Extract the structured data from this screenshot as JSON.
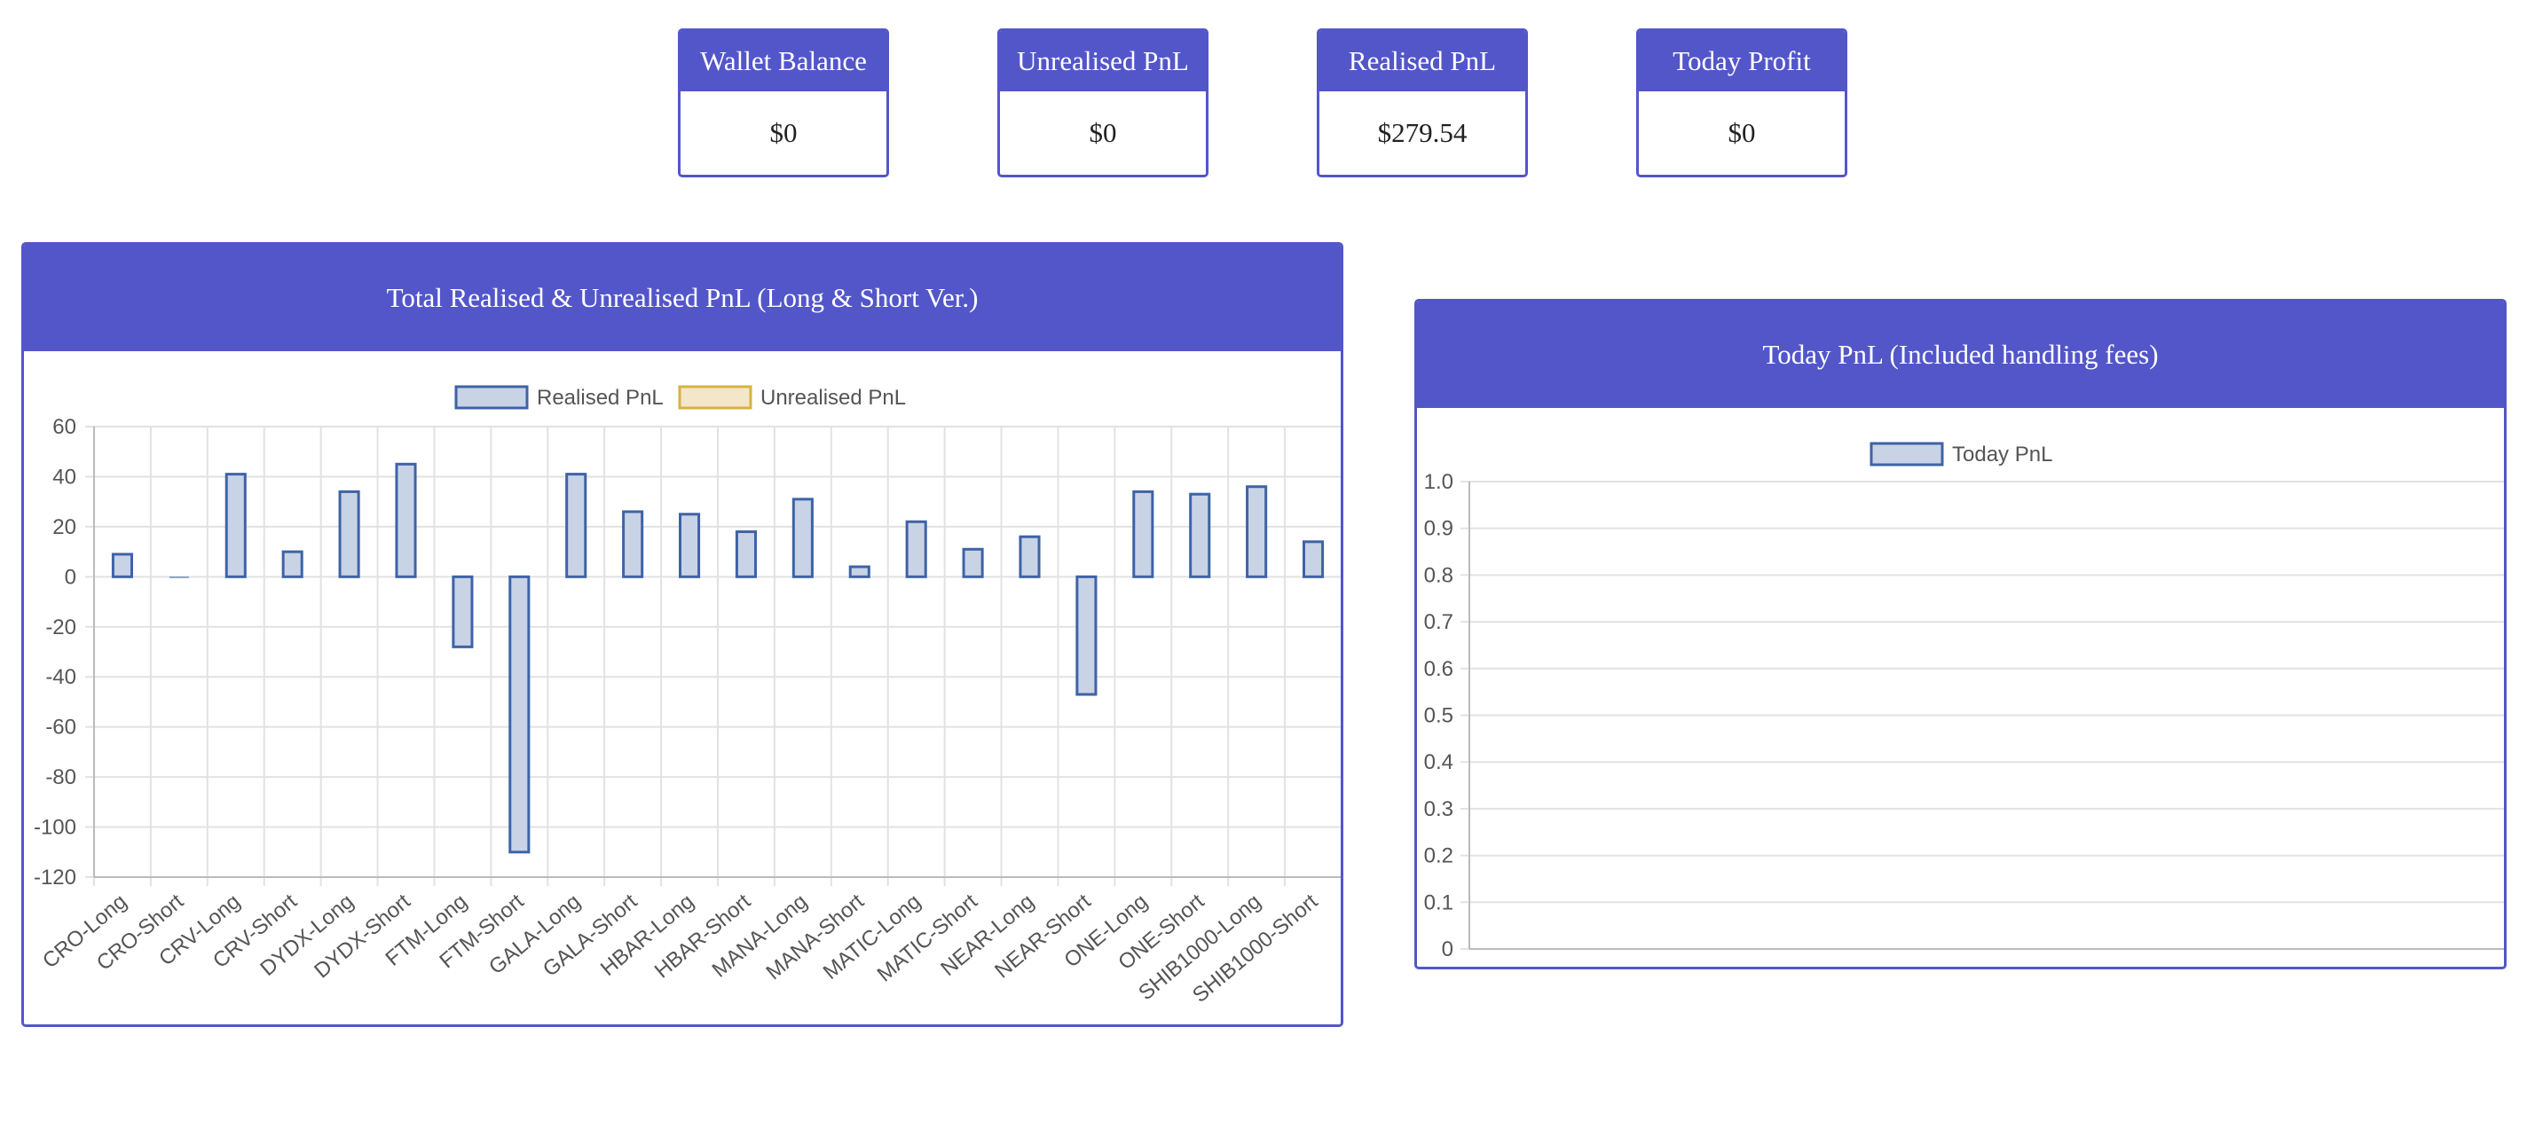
{
  "stats": [
    {
      "label": "Wallet Balance",
      "value": "$0"
    },
    {
      "label": "Unrealised PnL",
      "value": "$0"
    },
    {
      "label": "Realised PnL",
      "value": "$279.54"
    },
    {
      "label": "Today Profit",
      "value": "$0"
    }
  ],
  "panels": {
    "total": {
      "title": "Total Realised & Unrealised PnL (Long & Short Ver.)"
    },
    "today": {
      "title": "Today PnL (Included handling fees)"
    }
  },
  "colors": {
    "accent": "#5356c9",
    "bar_fill": "#c9d3e6",
    "bar_stroke": "#3e63a6",
    "unrealised_fill": "#f4e6c8",
    "unrealised_stroke": "#d8b23e",
    "grid": "#e2e2e2"
  },
  "chart_data": [
    {
      "type": "bar",
      "categories": [
        "CRO-Long",
        "CRO-Short",
        "CRV-Long",
        "CRV-Short",
        "DYDX-Long",
        "DYDX-Short",
        "FTM-Long",
        "FTM-Short",
        "GALA-Long",
        "GALA-Short",
        "HBAR-Long",
        "HBAR-Short",
        "MANA-Long",
        "MANA-Short",
        "MATIC-Long",
        "MATIC-Short",
        "NEAR-Long",
        "NEAR-Short",
        "ONE-Long",
        "ONE-Short",
        "SHIB1000-Long",
        "SHIB1000-Short"
      ],
      "series": [
        {
          "name": "Realised PnL",
          "values": [
            9,
            0,
            41,
            10,
            34,
            45,
            -28,
            -110,
            41,
            26,
            25,
            18,
            31,
            4,
            22,
            11,
            16,
            -47,
            34,
            33,
            36,
            14
          ]
        },
        {
          "name": "Unrealised PnL",
          "values": [
            0,
            0,
            0,
            0,
            0,
            0,
            0,
            0,
            0,
            0,
            0,
            0,
            0,
            0,
            0,
            0,
            0,
            0,
            0,
            0,
            0,
            0
          ]
        }
      ],
      "ylim": [
        -120,
        60
      ],
      "yticks": [
        60,
        40,
        20,
        0,
        -20,
        -40,
        -60,
        -80,
        -100,
        -120
      ],
      "grid": true,
      "legend": "top"
    },
    {
      "type": "bar",
      "categories": [],
      "series": [
        {
          "name": "Today PnL",
          "values": []
        }
      ],
      "ylim": [
        0,
        1
      ],
      "yticks": [
        "1.0",
        "0.9",
        "0.8",
        "0.7",
        "0.6",
        "0.5",
        "0.4",
        "0.3",
        "0.2",
        "0.1",
        "0"
      ],
      "grid": true,
      "legend": "top"
    }
  ]
}
